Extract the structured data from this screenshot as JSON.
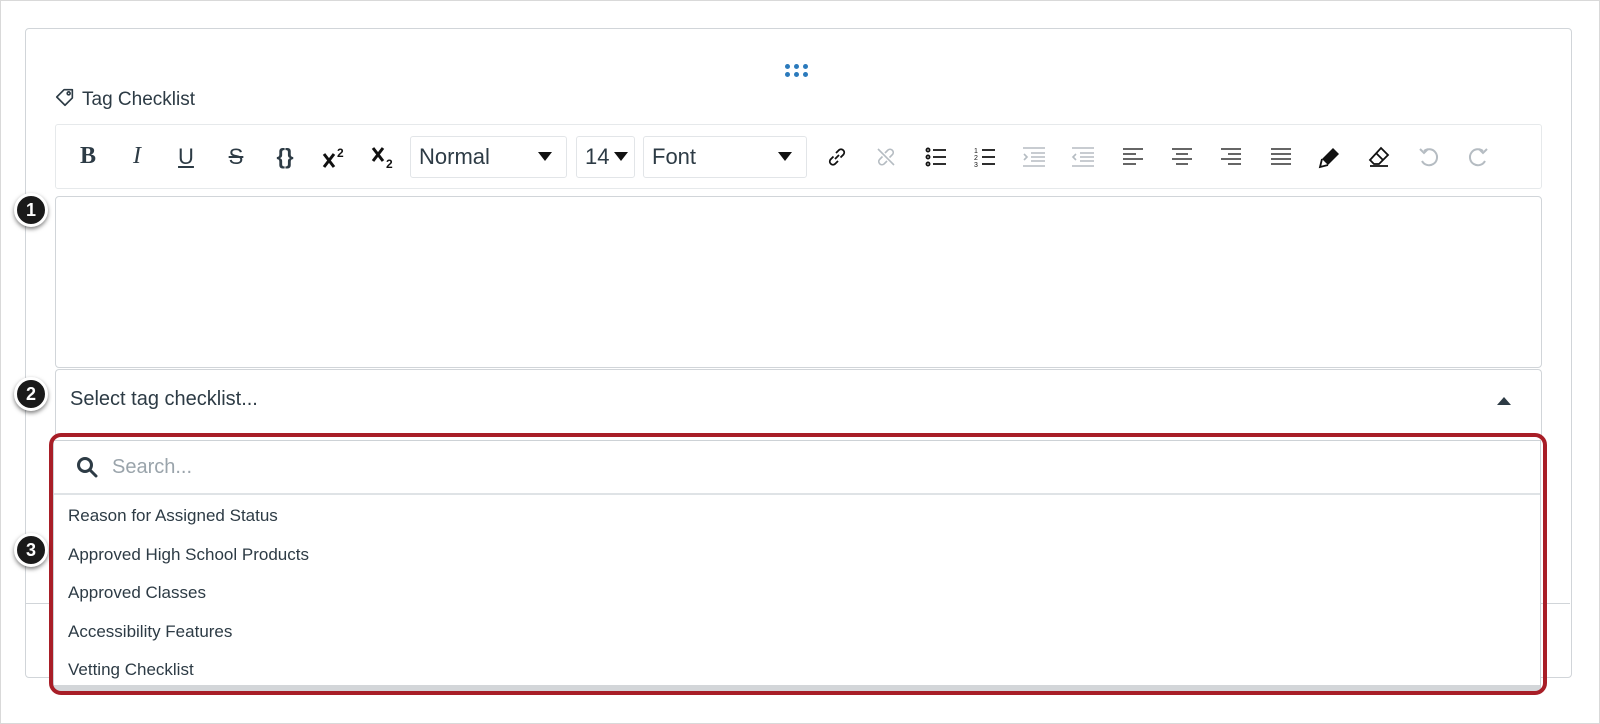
{
  "tag_title": "Tag Checklist",
  "toolbar": {
    "bold": "B",
    "italic": "I",
    "underline": "U",
    "strike": "S",
    "code": "{}",
    "paragraph_style": "Normal",
    "font_size": "14",
    "font_family": "Font",
    "icons": [
      "bold-icon",
      "italic-icon",
      "underline-icon",
      "strikethrough-icon",
      "code-icon",
      "superscript-icon",
      "subscript-icon",
      "link-icon",
      "unlink-icon",
      "bullet-list-icon",
      "numbered-list-icon",
      "indent-icon",
      "outdent-icon",
      "align-left-icon",
      "align-center-icon",
      "align-right-icon",
      "align-justify-icon",
      "highlight-pen-icon",
      "clear-format-icon",
      "undo-icon",
      "redo-icon"
    ]
  },
  "select": {
    "placeholder": "Select tag checklist..."
  },
  "dropdown": {
    "search_placeholder": "Search...",
    "options": [
      "Reason for Assigned Status",
      "Approved High School Products",
      "Approved Classes",
      "Accessibility Features",
      "Vetting Checklist"
    ]
  },
  "callouts": [
    "1",
    "2",
    "3"
  ],
  "colors": {
    "accent_blue": "#2b7abc",
    "highlight_red": "#a81e27",
    "text": "#2d3b45"
  }
}
